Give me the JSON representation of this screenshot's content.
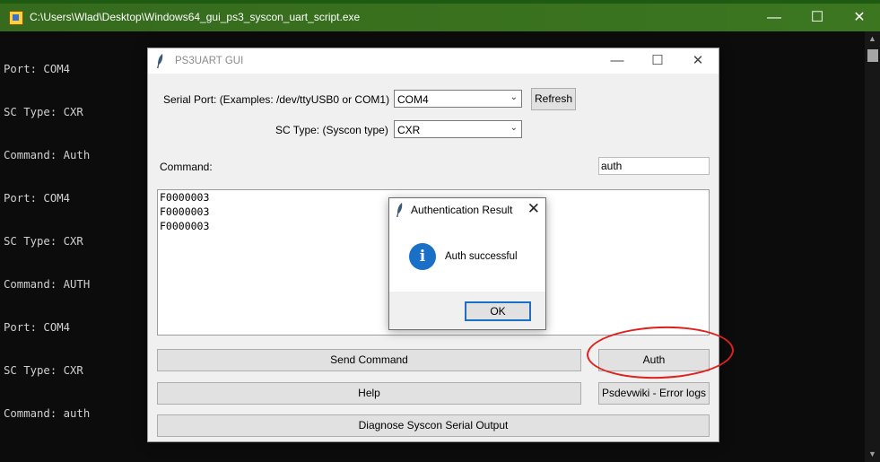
{
  "console": {
    "title": "C:\\Users\\Wlad\\Desktop\\Windows64_gui_ps3_syscon_uart_script.exe",
    "lines": [
      "Port: COM4",
      "SC Type: CXR",
      "Command: Auth",
      "Port: COM4",
      "SC Type: CXR",
      "Command: AUTH",
      "Port: COM4",
      "SC Type: CXR",
      "Command: auth"
    ]
  },
  "gui": {
    "title": "PS3UART GUI",
    "serial_port_label": "Serial Port: (Examples: /dev/ttyUSB0 or COM1)",
    "serial_port_value": "COM4",
    "refresh_label": "Refresh",
    "sc_type_label": "SC Type: (Syscon type)",
    "sc_type_value": "CXR",
    "command_label": "Command:",
    "command_value": "auth",
    "output_lines": [
      "F0000003",
      "F0000003",
      "F0000003"
    ],
    "send_command_label": "Send Command",
    "auth_label": "Auth",
    "help_label": "Help",
    "psdevwiki_label": "Psdevwiki - Error logs",
    "diagnose_label": "Diagnose Syscon Serial Output"
  },
  "dialog": {
    "title": "Authentication Result",
    "message": "Auth successful",
    "ok_label": "OK"
  },
  "colors": {
    "annotation": "#e0201a",
    "info_icon": "#1a6fc7"
  }
}
